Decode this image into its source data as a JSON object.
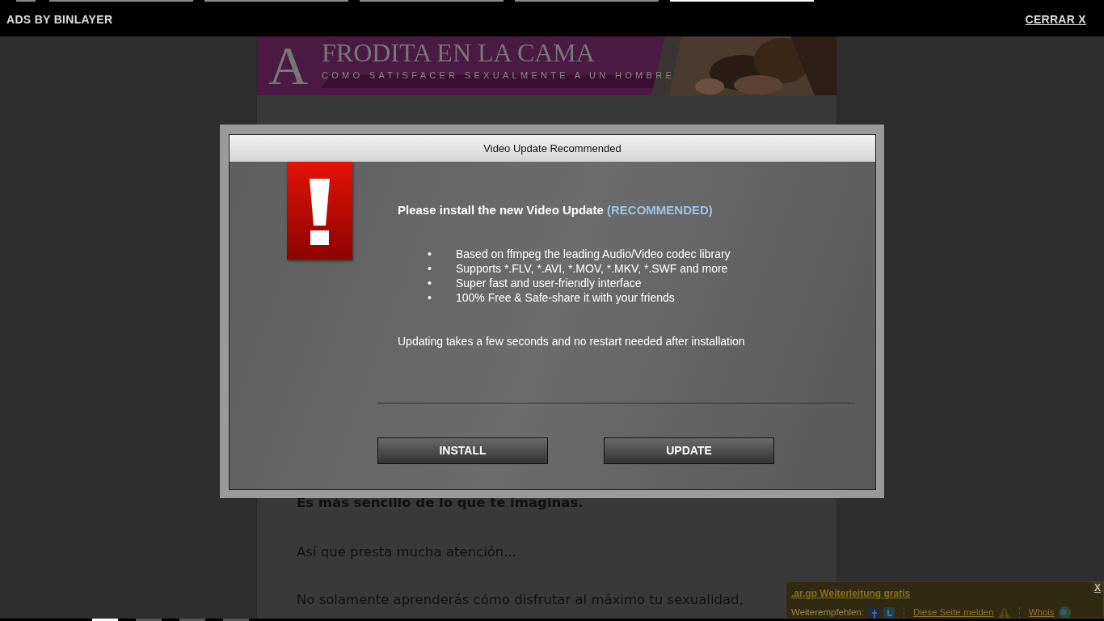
{
  "top_bar": {
    "indicators": [
      {
        "selected": false
      },
      {
        "selected": false
      },
      {
        "selected": false
      },
      {
        "selected": false
      },
      {
        "selected": false
      },
      {
        "selected": true
      }
    ],
    "label": "ADS BY BINLAYER",
    "close": "CERRAR X"
  },
  "banner": {
    "title_initial": "A",
    "title_rest": "FRODITA EN LA CAMA",
    "subtitle": "COMO SATISFACER SEXUALMENTE A UN HOMBRE"
  },
  "article": {
    "paragraphs": [
      {
        "text": "Es más sencillo de lo que te imaginas.",
        "bold": true
      },
      {
        "text": "Así que presta mucha atención...",
        "bold": false
      },
      {
        "text": "No solamente aprenderás cómo disfrutar al máximo tu sexualidad,",
        "bold": false
      }
    ]
  },
  "dialog": {
    "title": "Video Update Recommended",
    "heading": "Please install the new Video Update",
    "heading_tag": "(RECOMMENDED)",
    "bullets": [
      "Based on ffmpeg the leading Audio/Video codec library",
      "Supports *.FLV, *.AVI, *.MOV, *.MKV, *.SWF and more",
      "Super fast and user-friendly interface",
      "100% Free & Safe-share it with your friends"
    ],
    "bullet_mark": "•",
    "note": "Updating takes a few seconds and no restart needed after installation",
    "buttons": [
      "INSTALL",
      "UPDATE"
    ]
  },
  "ad_bar": {
    "link": ".ar.gp Weiterleitung gratis",
    "share_label": "Weiterempfehlen:",
    "report": "Diese Seite melden",
    "whois": "Whois",
    "close": "X"
  },
  "bottom_indicators": [
    {
      "selected": true
    },
    {
      "selected": false
    },
    {
      "selected": false
    },
    {
      "selected": false
    }
  ]
}
